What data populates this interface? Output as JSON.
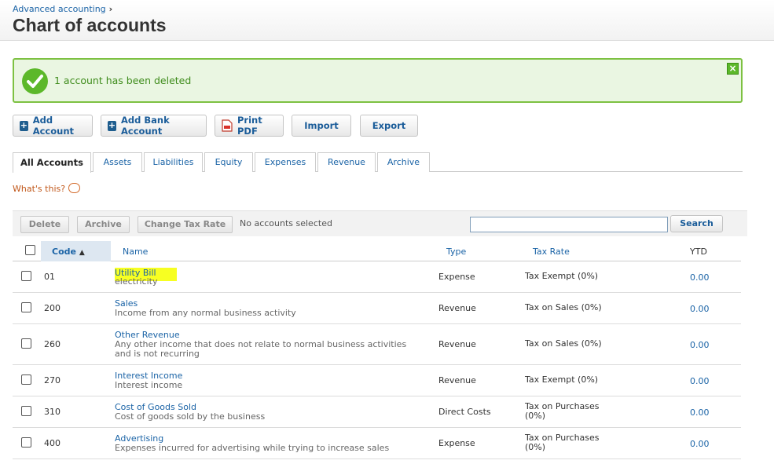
{
  "breadcrumb": "Advanced accounting",
  "title": "Chart of accounts",
  "banner": {
    "message": "1 account has been deleted"
  },
  "toolbar": {
    "add_account": "Add Account",
    "add_bank_account": "Add Bank Account",
    "print_pdf": "Print PDF",
    "import": "Import",
    "export": "Export"
  },
  "tabs": [
    "All Accounts",
    "Assets",
    "Liabilities",
    "Equity",
    "Expenses",
    "Revenue",
    "Archive"
  ],
  "whats_this": "What's this?",
  "actions": {
    "delete": "Delete",
    "archive": "Archive",
    "change_tax_rate": "Change Tax Rate",
    "selection_status": "No accounts selected",
    "search": "Search",
    "search_value": ""
  },
  "columns": {
    "code": "Code",
    "name": "Name",
    "type": "Type",
    "tax_rate": "Tax Rate",
    "ytd": "YTD"
  },
  "rows": [
    {
      "code": "01",
      "name": "Utility Bill",
      "desc": "electricity",
      "type": "Expense",
      "tax": "Tax Exempt (0%)",
      "ytd": "0.00"
    },
    {
      "code": "200",
      "name": "Sales",
      "desc": "Income from any normal business activity",
      "type": "Revenue",
      "tax": "Tax on Sales (0%)",
      "ytd": "0.00"
    },
    {
      "code": "260",
      "name": "Other Revenue",
      "desc": "Any other income that does not relate to normal business activities and is not recurring",
      "type": "Revenue",
      "tax": "Tax on Sales (0%)",
      "ytd": "0.00"
    },
    {
      "code": "270",
      "name": "Interest Income",
      "desc": "Interest income",
      "type": "Revenue",
      "tax": "Tax Exempt (0%)",
      "ytd": "0.00"
    },
    {
      "code": "310",
      "name": "Cost of Goods Sold",
      "desc": "Cost of goods sold by the business",
      "type": "Direct Costs",
      "tax": "Tax on Purchases (0%)",
      "ytd": "0.00"
    },
    {
      "code": "400",
      "name": "Advertising",
      "desc": "Expenses incurred for advertising while trying to increase sales",
      "type": "Expense",
      "tax": "Tax on Purchases (0%)",
      "ytd": "0.00"
    }
  ],
  "colors": {
    "accent": "#1a63a6",
    "success": "#5cb82a",
    "highlight": "#f7ff22"
  }
}
